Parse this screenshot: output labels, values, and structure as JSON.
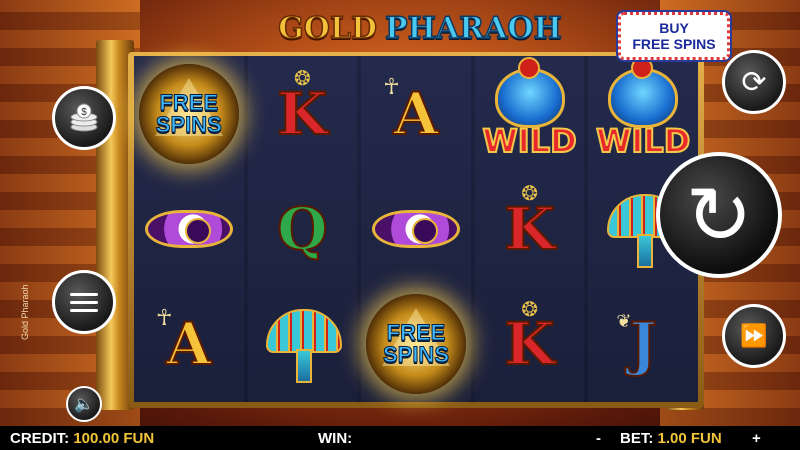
{
  "game": {
    "title_part1": "GOLD",
    "title_part2": "PHARAOH",
    "side_label": "Gold Pharaoh",
    "buy_free_spins_line1": "BUY",
    "buy_free_spins_line2": "FREE SPINS"
  },
  "reels": [
    [
      {
        "type": "free_spins",
        "text": "FREE\nSPINS"
      },
      {
        "type": "eye"
      },
      {
        "type": "letter",
        "text": "A",
        "mark": "ankh"
      }
    ],
    [
      {
        "type": "letter",
        "text": "K",
        "mark": "crown"
      },
      {
        "type": "letter",
        "text": "Q"
      },
      {
        "type": "fan"
      }
    ],
    [
      {
        "type": "letter",
        "text": "A",
        "mark": "ankh"
      },
      {
        "type": "eye"
      },
      {
        "type": "free_spins",
        "text": "FREE\nSPINS"
      }
    ],
    [
      {
        "type": "wild",
        "text": "WILD"
      },
      {
        "type": "letter",
        "text": "K",
        "mark": "crown"
      },
      {
        "type": "letter",
        "text": "K",
        "mark": "crown"
      }
    ],
    [
      {
        "type": "wild",
        "text": "WILD"
      },
      {
        "type": "fan"
      },
      {
        "type": "letter",
        "text": "J",
        "mark": "bird"
      }
    ]
  ],
  "controls": {
    "coins_icon": "coin-stack-icon",
    "menu_icon": "hamburger-menu-icon",
    "sound_icon": "speaker-icon",
    "autoplay_icon": "autoplay-icon",
    "spin_icon": "spin-arrow-icon",
    "turbo_icon": "fast-forward-icon"
  },
  "status": {
    "credit_label": "CREDIT:",
    "credit_value": "100.00 FUN",
    "win_label": "WIN:",
    "win_value": "",
    "bet_minus": "-",
    "bet_label": "BET:",
    "bet_value": "1.00 FUN",
    "bet_plus": "+"
  }
}
